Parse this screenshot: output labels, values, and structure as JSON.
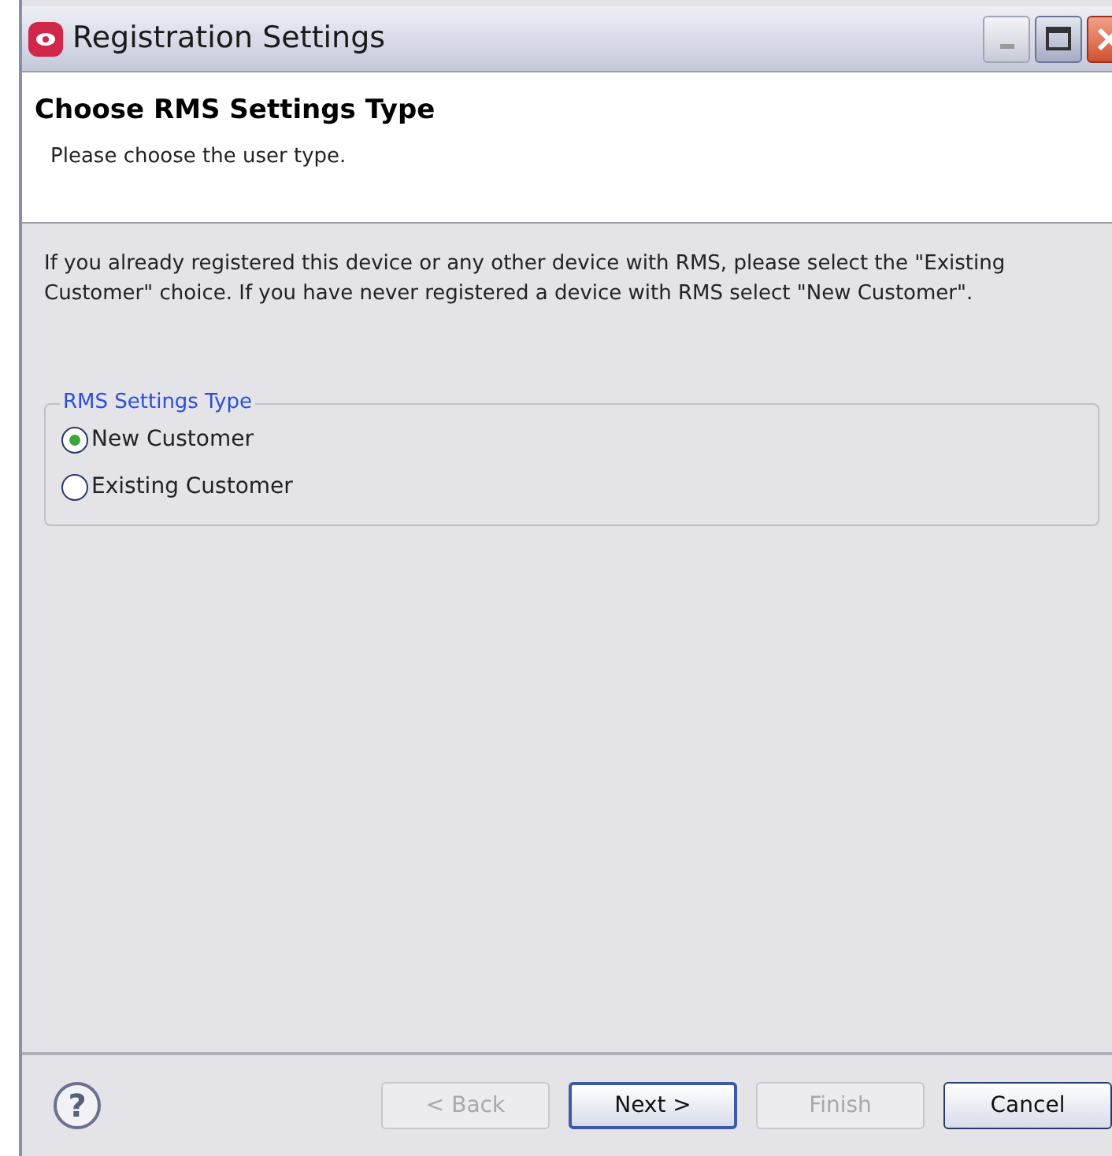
{
  "window": {
    "title": "Registration Settings"
  },
  "header": {
    "title": "Choose RMS Settings Type",
    "subtitle": "Please choose the user type."
  },
  "description": "If you already registered this device or any other device with RMS, please select the \"Existing Customer\" choice. If you have never registered a device with RMS select \"New Customer\".",
  "group": {
    "title": "RMS Settings Type",
    "options": [
      {
        "label": "New Customer",
        "selected": true
      },
      {
        "label": "Existing Customer",
        "selected": false
      }
    ]
  },
  "help": "?",
  "buttons": [
    {
      "label": "< Back",
      "disabled": true,
      "default": false
    },
    {
      "label": "Next >",
      "disabled": false,
      "default": true
    },
    {
      "label": "Finish",
      "disabled": true,
      "default": false
    },
    {
      "label": "Cancel",
      "disabled": false,
      "default": false
    }
  ]
}
